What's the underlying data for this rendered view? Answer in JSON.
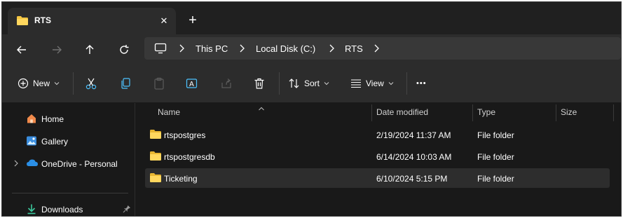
{
  "tab": {
    "title": "RTS",
    "close_glyph": "✕",
    "new_tab_glyph": "+"
  },
  "breadcrumb": {
    "items": [
      "This PC",
      "Local Disk (C:)",
      "RTS"
    ]
  },
  "toolbar": {
    "new_label": "New",
    "sort_label": "Sort",
    "view_label": "View",
    "more_glyph": "•••"
  },
  "nav": {
    "items": [
      {
        "label": "Home",
        "icon": "home-icon"
      },
      {
        "label": "Gallery",
        "icon": "gallery-icon"
      },
      {
        "label": "OneDrive - Personal",
        "icon": "cloud-icon"
      },
      {
        "label": "Downloads",
        "icon": "download-icon"
      }
    ]
  },
  "columns": {
    "name": "Name",
    "date": "Date modified",
    "type": "Type",
    "size": "Size"
  },
  "files": [
    {
      "name": "rtspostgres",
      "date": "2/19/2024 11:37 AM",
      "type": "File folder"
    },
    {
      "name": "rtspostgresdb",
      "date": "6/14/2024 10:03 AM",
      "type": "File folder"
    },
    {
      "name": "Ticketing",
      "date": "6/10/2024 5:15 PM",
      "type": "File folder"
    }
  ],
  "colors": {
    "folder": "#f4c542",
    "background": "#191919",
    "toolbar": "#2c2c2c",
    "accent": "#4cc2ff"
  }
}
